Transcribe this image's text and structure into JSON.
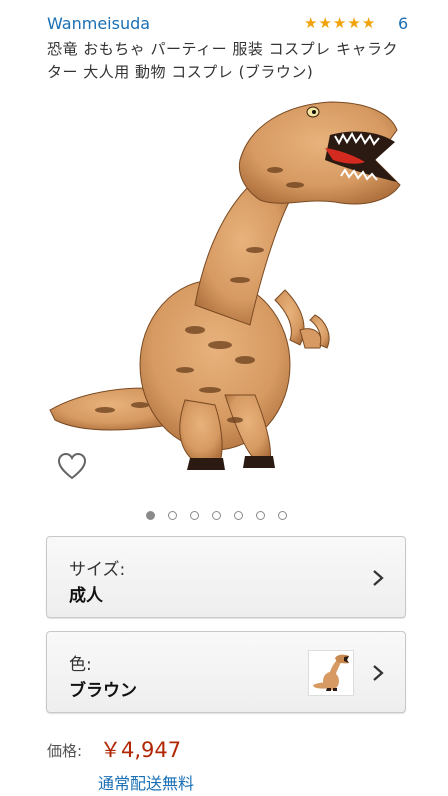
{
  "product": {
    "brand": "Wanmeisuda",
    "rating_stars": 5,
    "review_count": "6",
    "title": "恐竜 おもちゃ パーティー 服装 コスプレ キャラクター 大人用 動物 コスプレ (ブラウン)"
  },
  "gallery": {
    "image_subject": "inflatable-trex-costume",
    "image_count": 7,
    "active_index": 0
  },
  "size_selector": {
    "label": "サイズ:",
    "value": "成人"
  },
  "color_selector": {
    "label": "色:",
    "value": "ブラウン"
  },
  "price": {
    "label": "価格:",
    "value": "￥4,947"
  },
  "shipping": {
    "text": "通常配送無料"
  },
  "colors": {
    "link": "#1a6fb4",
    "price": "#b12704",
    "star": "#f0a30a",
    "dino_body": "#d69a62"
  }
}
